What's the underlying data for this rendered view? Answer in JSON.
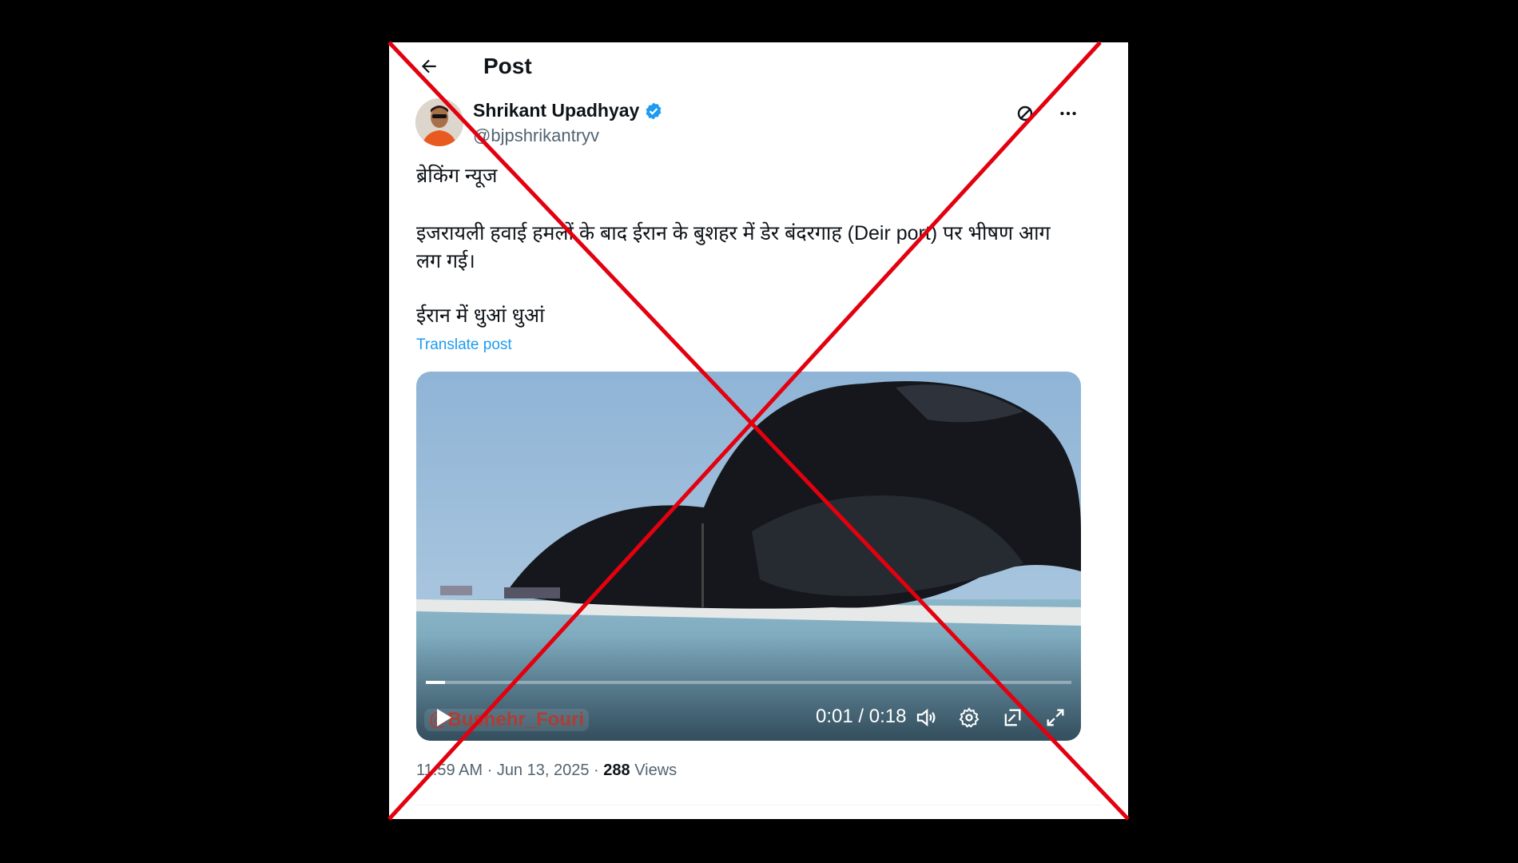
{
  "header": {
    "back_icon": "arrow-left-icon",
    "title": "Post"
  },
  "author": {
    "name": "Shrikant Upadhyay",
    "handle": "@bjpshrikantryv",
    "verified_icon": "verified-badge-icon",
    "verified_color": "#1d9bf0"
  },
  "actions": {
    "grok_icon": "grok-icon",
    "more_icon": "more-icon"
  },
  "post": {
    "line1": "ब्रेकिंग न्यूज",
    "line2": "इजरायली हवाई हमलों के बाद ईरान के बुशहर में डेर बंदरगाह (Deir port) पर भीषण आग लग गई।",
    "line3": "ईरान में धुआं धुआं",
    "translate": "Translate post"
  },
  "video": {
    "timecode": "0:01 / 0:18",
    "progress": 0.03,
    "watermark": "@Bushehr_Fouri"
  },
  "meta": {
    "time": "11:59 AM",
    "date": "Jun 13, 2025",
    "views_count": "288",
    "views_label": "Views"
  },
  "colors": {
    "accent": "#1d9bf0",
    "cross": "#e3000f",
    "background": "#000000"
  }
}
